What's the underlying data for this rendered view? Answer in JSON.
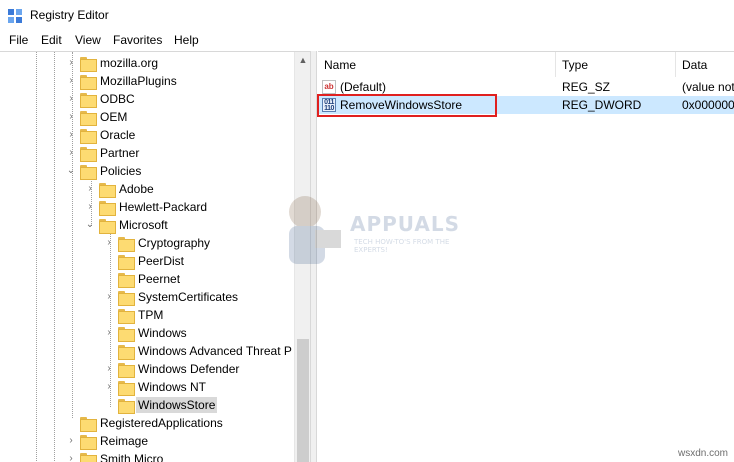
{
  "window": {
    "title": "Registry Editor"
  },
  "menu": [
    "File",
    "Edit",
    "View",
    "Favorites",
    "Help"
  ],
  "tree": [
    {
      "label": "mozilla.org",
      "expander": "›"
    },
    {
      "label": "MozillaPlugins",
      "expander": "›"
    },
    {
      "label": "ODBC",
      "expander": "›"
    },
    {
      "label": "OEM",
      "expander": "›"
    },
    {
      "label": "Oracle",
      "expander": "›"
    },
    {
      "label": "Partner",
      "expander": "›"
    },
    {
      "label": "Policies",
      "expander": "⌄"
    },
    {
      "label": "Adobe",
      "expander": "›"
    },
    {
      "label": "Hewlett-Packard",
      "expander": "›"
    },
    {
      "label": "Microsoft",
      "expander": "⌄"
    },
    {
      "label": "Cryptography",
      "expander": "›"
    },
    {
      "label": "PeerDist",
      "expander": ""
    },
    {
      "label": "Peernet",
      "expander": ""
    },
    {
      "label": "SystemCertificates",
      "expander": "›"
    },
    {
      "label": "TPM",
      "expander": ""
    },
    {
      "label": "Windows",
      "expander": "›"
    },
    {
      "label": "Windows Advanced Threat P",
      "expander": ""
    },
    {
      "label": "Windows Defender",
      "expander": "›"
    },
    {
      "label": "Windows NT",
      "expander": "›"
    },
    {
      "label": "WindowsStore",
      "expander": ""
    },
    {
      "label": "RegisteredApplications",
      "expander": ""
    },
    {
      "label": "Reimage",
      "expander": "›"
    },
    {
      "label": "Smith Micro",
      "expander": "›"
    }
  ],
  "columns": {
    "name": "Name",
    "type": "Type",
    "data": "Data"
  },
  "values": [
    {
      "name": "(Default)",
      "type": "REG_SZ",
      "data": "(value not",
      "icon": "ab"
    },
    {
      "name": "RemoveWindowsStore",
      "type": "REG_DWORD",
      "data": "0x0000000",
      "icon": "011\n110"
    }
  ],
  "watermark": {
    "brand": "APPUALS",
    "tagline": "TECH HOW-TO'S FROM THE EXPERTS!"
  },
  "corner_mark": "wsxdn.com",
  "colors": {
    "selection": "#cce8ff",
    "highlight_box": "#e0201f",
    "folder": "#fddb72"
  }
}
